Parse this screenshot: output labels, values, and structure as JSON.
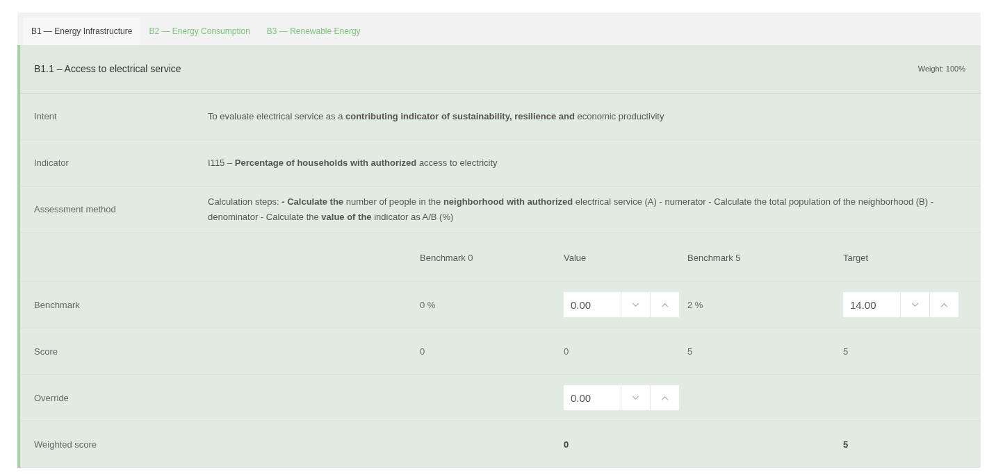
{
  "tabs": [
    {
      "label": "B1 — Energy Infrastructure",
      "selected": true
    },
    {
      "label": "B2 — Energy Consumption",
      "selected": false
    },
    {
      "label": "B3 — Renewable Energy",
      "selected": false
    }
  ],
  "section": {
    "title": "B1.1 – Access to electrical service",
    "weight": "Weight: 100%"
  },
  "info_rows": [
    {
      "label": "Intent",
      "text": "To evaluate electrical service as a **contributing indicator of sustainability, resilience and** economic productivity"
    },
    {
      "label": "Indicator",
      "text": "I115 – **Percentage of households with authorized** access to electricity"
    },
    {
      "label": "Assessment method",
      "text": "Calculation steps: **- Calculate the** number of people in the **neighborhood with authorized** electrical service (A) - numerator - Calculate the total population of the neighborhood (B) - denominator - Calculate the **value of the** indicator as A/B (%)"
    }
  ],
  "table": {
    "columns": [
      "Benchmark 0",
      "Value",
      "Benchmark 5",
      "Target"
    ],
    "rows": [
      {
        "label": "Benchmark",
        "emphasis": false,
        "cells": [
          {
            "kind": "text",
            "text": "0 %"
          },
          {
            "kind": "spinner",
            "value": "0.00"
          },
          {
            "kind": "text",
            "text": "2 %"
          },
          {
            "kind": "spinner",
            "value": "14.00"
          }
        ]
      },
      {
        "label": "Score",
        "emphasis": false,
        "cells": [
          {
            "kind": "text",
            "text": "0"
          },
          {
            "kind": "text",
            "text": "0"
          },
          {
            "kind": "text",
            "text": "5"
          },
          {
            "kind": "text",
            "text": "5"
          }
        ]
      },
      {
        "label": "Override",
        "emphasis": false,
        "cells": [
          {
            "kind": "empty"
          },
          {
            "kind": "spinner",
            "value": "0.00"
          },
          {
            "kind": "empty"
          },
          {
            "kind": "empty"
          }
        ]
      },
      {
        "label": "Weighted score",
        "emphasis": true,
        "cells": [
          {
            "kind": "empty"
          },
          {
            "kind": "text",
            "text": "0"
          },
          {
            "kind": "empty"
          },
          {
            "kind": "text",
            "text": "5"
          }
        ]
      }
    ]
  }
}
